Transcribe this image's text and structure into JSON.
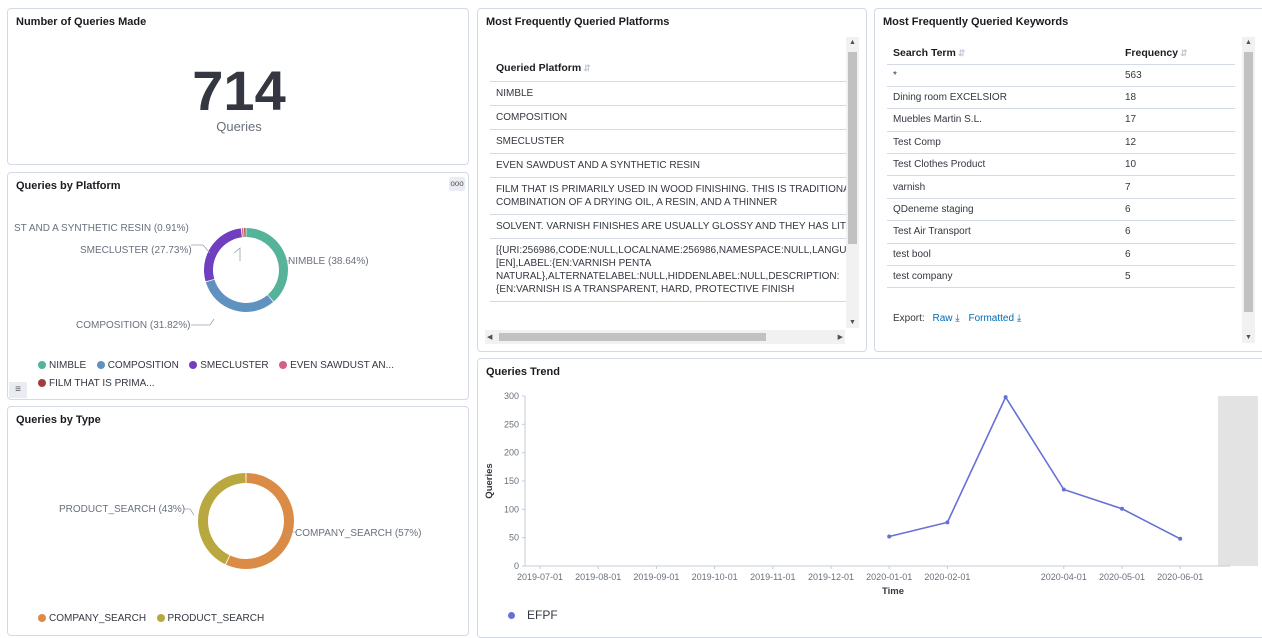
{
  "count_panel": {
    "title": "Number of Queries Made",
    "value": "714",
    "label": "Queries"
  },
  "platform_table": {
    "title": "Most Frequently Queried Platforms",
    "header": "Queried Platform",
    "rows": [
      [
        "NIMBLE"
      ],
      [
        "COMPOSITION"
      ],
      [
        "SMECLUSTER"
      ],
      [
        "EVEN SAWDUST AND A SYNTHETIC RESIN"
      ],
      [
        "FILM THAT IS PRIMARILY USED IN WOOD FINISHING. THIS IS TRADITIONA",
        "COMBINATION OF A DRYING OIL, A RESIN, AND A THINNER"
      ],
      [
        "SOLVENT. VARNISH FINISHES ARE USUALLY GLOSSY AND THEY HAS LITT"
      ],
      [
        "[{URI:256986,CODE:NULL,LOCALNAME:256986,NAMESPACE:NULL,LANGU",
        "[EN],LABEL:{EN:VARNISH PENTA",
        "NATURAL},ALTERNATELABEL:NULL,HIDDENLABEL:NULL,DESCRIPTION:",
        "{EN:VARNISH IS A TRANSPARENT, HARD, PROTECTIVE FINISH"
      ]
    ]
  },
  "keyword_table": {
    "title": "Most Frequently Queried Keywords",
    "col_term": "Search Term",
    "col_freq": "Frequency",
    "rows": [
      {
        "term": "*",
        "freq": "563"
      },
      {
        "term": "Dining room EXCELSIOR",
        "freq": "18"
      },
      {
        "term": "Muebles Martin S.L.",
        "freq": "17"
      },
      {
        "term": "Test Comp",
        "freq": "12"
      },
      {
        "term": "Test Clothes Product",
        "freq": "10"
      },
      {
        "term": "varnish",
        "freq": "7"
      },
      {
        "term": "QDeneme staging",
        "freq": "6"
      },
      {
        "term": "Test Air Transport",
        "freq": "6"
      },
      {
        "term": "test bool",
        "freq": "6"
      },
      {
        "term": "test company",
        "freq": "5"
      }
    ],
    "export_label": "Export:",
    "export_raw": "Raw",
    "export_formatted": "Formatted"
  },
  "platform_donut": {
    "title": "Queries by Platform",
    "options_icon": "ooo",
    "slice_labels": [
      "NIMBLE (38.64%)",
      "COMPOSITION (31.82%)",
      "SMECLUSTER (27.73%)",
      "ST AND A SYNTHETIC RESIN (0.91%)"
    ],
    "legend": [
      "NIMBLE",
      "COMPOSITION",
      "SMECLUSTER",
      "EVEN SAWDUST AN...",
      "FILM THAT IS PRIMA..."
    ]
  },
  "type_donut": {
    "title": "Queries by Type",
    "slice_labels": [
      "PRODUCT_SEARCH (43%)",
      "COMPANY_SEARCH (57%)"
    ],
    "legend": [
      "COMPANY_SEARCH",
      "PRODUCT_SEARCH"
    ]
  },
  "trend": {
    "title": "Queries Trend",
    "legend_label": "EFPF"
  },
  "colors": {
    "nimble": "#54b399",
    "composition": "#6092c0",
    "smecluster": "#6f3fbf",
    "sawdust": "#d36086",
    "film": "#a03c3c",
    "company": "#da8b45",
    "product": "#b9a83f",
    "line": "#6670d6"
  },
  "chart_data": [
    {
      "type": "pie",
      "title": "Queries by Platform",
      "categories": [
        "NIMBLE",
        "COMPOSITION",
        "SMECLUSTER",
        "EVEN SAWDUST AND A SYNTHETIC RESIN",
        "FILM THAT IS PRIMARILY USED IN WOOD FINISHING"
      ],
      "values": [
        38.64,
        31.82,
        27.73,
        0.91,
        0.9
      ],
      "legend": "bottom"
    },
    {
      "type": "pie",
      "title": "Queries by Type",
      "categories": [
        "COMPANY_SEARCH",
        "PRODUCT_SEARCH"
      ],
      "values": [
        57,
        43
      ],
      "legend": "bottom"
    },
    {
      "type": "line",
      "title": "Queries Trend",
      "xlabel": "Time",
      "ylabel": "Queries",
      "ylim": [
        0,
        300
      ],
      "yticks": [
        0,
        50,
        100,
        150,
        200,
        250,
        300
      ],
      "xticks": [
        "2019-07-01",
        "2019-08-01",
        "2019-09-01",
        "2019-10-01",
        "2019-11-01",
        "2019-12-01",
        "2020-01-01",
        "2020-02-01",
        "2020-04-01",
        "2020-05-01",
        "2020-06-01"
      ],
      "series": [
        {
          "name": "EFPF",
          "x": [
            "2020-01-01",
            "2020-02-01",
            "2020-03-01",
            "2020-04-01",
            "2020-05-01",
            "2020-06-01"
          ],
          "values": [
            52,
            77,
            298,
            135,
            101,
            48
          ]
        }
      ],
      "grid": false,
      "legend": "bottom-left"
    }
  ]
}
